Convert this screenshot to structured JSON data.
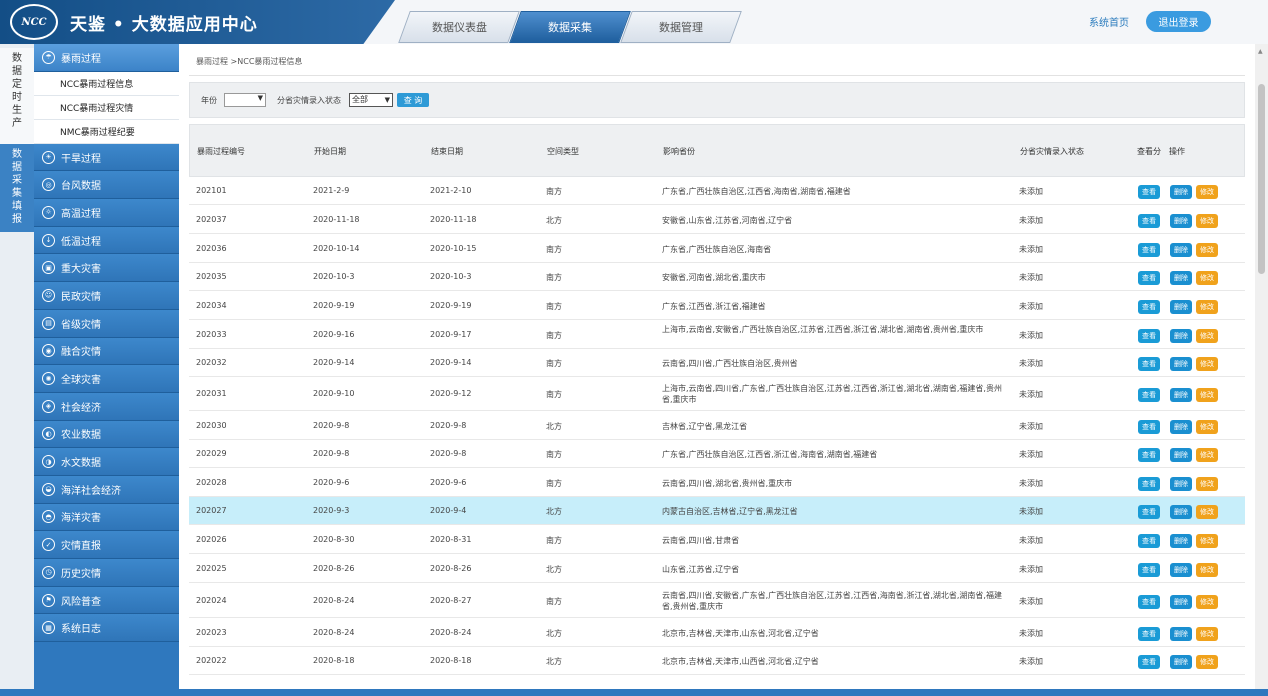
{
  "header": {
    "logo_text": "NCC",
    "title": "天鉴 • 大数据应用中心",
    "tabs": [
      {
        "label": "数据仪表盘"
      },
      {
        "label": "数据采集"
      },
      {
        "label": "数据管理"
      }
    ],
    "home_link": "系统首页",
    "logout": "退出登录"
  },
  "side_tabs": {
    "produce": "数据定时生产",
    "collect": "数据采集填报"
  },
  "sidebar": {
    "storm": {
      "label": "暴雨过程",
      "icon": "cloud-rain-icon"
    },
    "storm_items": [
      "NCC暴雨过程信息",
      "NCC暴雨过程灾情",
      "NMC暴雨过程纪要"
    ],
    "groups": [
      {
        "label": "干旱过程",
        "icon": "drought-icon"
      },
      {
        "label": "台风数据",
        "icon": "typhoon-icon"
      },
      {
        "label": "高温过程",
        "icon": "thermometer-icon"
      },
      {
        "label": "低温过程",
        "icon": "snowflake-icon"
      },
      {
        "label": "重大灾害",
        "icon": "disaster-icon"
      },
      {
        "label": "民政灾情",
        "icon": "civil-icon"
      },
      {
        "label": "省级灾情",
        "icon": "province-icon"
      },
      {
        "label": "融合灾情",
        "icon": "merge-icon"
      },
      {
        "label": "全球灾害",
        "icon": "globe-icon"
      },
      {
        "label": "社会经济",
        "icon": "economy-icon"
      },
      {
        "label": "农业数据",
        "icon": "agriculture-icon"
      },
      {
        "label": "水文数据",
        "icon": "water-icon"
      },
      {
        "label": "海洋社会经济",
        "icon": "ocean-economy-icon"
      },
      {
        "label": "海洋灾害",
        "icon": "ocean-disaster-icon"
      },
      {
        "label": "灾情直报",
        "icon": "report-icon"
      },
      {
        "label": "历史灾情",
        "icon": "history-icon"
      },
      {
        "label": "风险普查",
        "icon": "risk-icon"
      },
      {
        "label": "系统日志",
        "icon": "log-icon"
      }
    ]
  },
  "breadcrumb": "暴雨过程 >NCC暴雨过程信息",
  "filter": {
    "year_label": "年份",
    "year_value": "",
    "status_label": "分省灾情录入状态",
    "status_value": "全部",
    "query": "查 询"
  },
  "table": {
    "columns": [
      "暴雨过程编号",
      "开始日期",
      "结束日期",
      "空间类型",
      "影响省份",
      "分省灾情录入状态",
      "查看分",
      "操作"
    ],
    "actions": {
      "view": "查看",
      "delete": "删除",
      "edit": "修改"
    },
    "rows": [
      {
        "id": "202101",
        "start": "2021-2-9",
        "end": "2021-2-10",
        "type": "南方",
        "provinces": "广东省,广西壮族自治区,江西省,海南省,湖南省,福建省",
        "status": "未添加"
      },
      {
        "id": "202037",
        "start": "2020-11-18",
        "end": "2020-11-18",
        "type": "北方",
        "provinces": "安徽省,山东省,江苏省,河南省,辽宁省",
        "status": "未添加"
      },
      {
        "id": "202036",
        "start": "2020-10-14",
        "end": "2020-10-15",
        "type": "南方",
        "provinces": "广东省,广西壮族自治区,海南省",
        "status": "未添加"
      },
      {
        "id": "202035",
        "start": "2020-10-3",
        "end": "2020-10-3",
        "type": "南方",
        "provinces": "安徽省,河南省,湖北省,重庆市",
        "status": "未添加"
      },
      {
        "id": "202034",
        "start": "2020-9-19",
        "end": "2020-9-19",
        "type": "南方",
        "provinces": "广东省,江西省,浙江省,福建省",
        "status": "未添加"
      },
      {
        "id": "202033",
        "start": "2020-9-16",
        "end": "2020-9-17",
        "type": "南方",
        "provinces": "上海市,云南省,安徽省,广西壮族自治区,江苏省,江西省,浙江省,湖北省,湖南省,贵州省,重庆市",
        "status": "未添加"
      },
      {
        "id": "202032",
        "start": "2020-9-14",
        "end": "2020-9-14",
        "type": "南方",
        "provinces": "云南省,四川省,广西壮族自治区,贵州省",
        "status": "未添加"
      },
      {
        "id": "202031",
        "start": "2020-9-10",
        "end": "2020-9-12",
        "type": "南方",
        "provinces": "上海市,云南省,四川省,广东省,广西壮族自治区,江苏省,江西省,浙江省,湖北省,湖南省,福建省,贵州省,重庆市",
        "status": "未添加"
      },
      {
        "id": "202030",
        "start": "2020-9-8",
        "end": "2020-9-8",
        "type": "北方",
        "provinces": "吉林省,辽宁省,黑龙江省",
        "status": "未添加"
      },
      {
        "id": "202029",
        "start": "2020-9-8",
        "end": "2020-9-8",
        "type": "南方",
        "provinces": "广东省,广西壮族自治区,江西省,浙江省,海南省,湖南省,福建省",
        "status": "未添加"
      },
      {
        "id": "202028",
        "start": "2020-9-6",
        "end": "2020-9-6",
        "type": "南方",
        "provinces": "云南省,四川省,湖北省,贵州省,重庆市",
        "status": "未添加"
      },
      {
        "id": "202027",
        "start": "2020-9-3",
        "end": "2020-9-4",
        "type": "北方",
        "provinces": "内蒙古自治区,吉林省,辽宁省,黑龙江省",
        "status": "未添加"
      },
      {
        "id": "202026",
        "start": "2020-8-30",
        "end": "2020-8-31",
        "type": "南方",
        "provinces": "云南省,四川省,甘肃省",
        "status": "未添加"
      },
      {
        "id": "202025",
        "start": "2020-8-26",
        "end": "2020-8-26",
        "type": "北方",
        "provinces": "山东省,江苏省,辽宁省",
        "status": "未添加"
      },
      {
        "id": "202024",
        "start": "2020-8-24",
        "end": "2020-8-27",
        "type": "南方",
        "provinces": "云南省,四川省,安徽省,广东省,广西壮族自治区,江苏省,江西省,海南省,浙江省,湖北省,湖南省,福建省,贵州省,重庆市",
        "status": "未添加"
      },
      {
        "id": "202023",
        "start": "2020-8-24",
        "end": "2020-8-24",
        "type": "北方",
        "provinces": "北京市,吉林省,天津市,山东省,河北省,辽宁省",
        "status": "未添加"
      },
      {
        "id": "202022",
        "start": "2020-8-18",
        "end": "2020-8-18",
        "type": "北方",
        "provinces": "北京市,吉林省,天津市,山西省,河北省,辽宁省",
        "status": "未添加"
      }
    ]
  }
}
